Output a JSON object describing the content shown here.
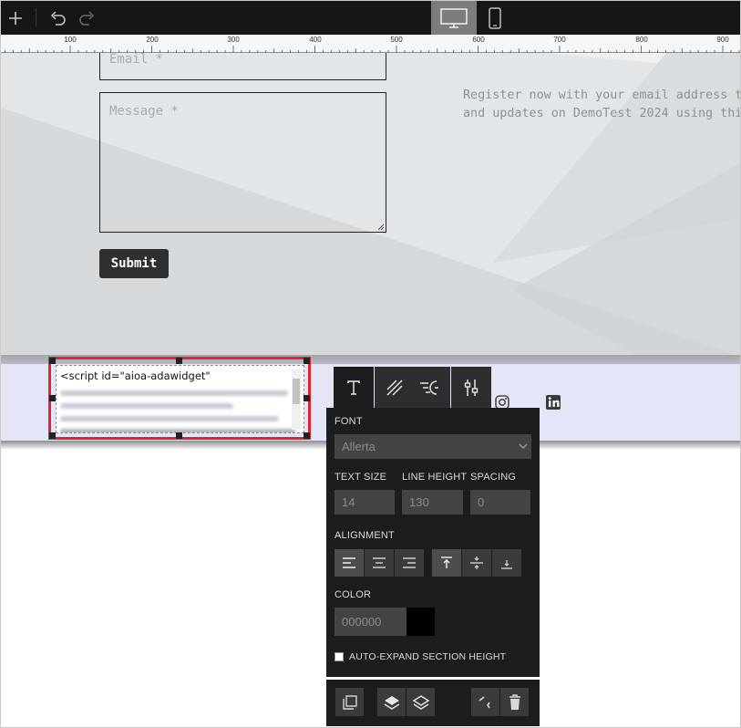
{
  "toolbar": {
    "add_icon": "plus-icon",
    "undo_icon": "undo-icon",
    "redo_icon": "redo-icon",
    "device_desktop_icon": "monitor-icon",
    "device_mobile_icon": "phone-icon",
    "active_device": "desktop"
  },
  "ruler": {
    "labels": [
      "100",
      "200",
      "300",
      "400",
      "500",
      "600",
      "700",
      "800",
      "900"
    ]
  },
  "form": {
    "email_placeholder": "Email *",
    "message_placeholder": "Message *",
    "submit_label": "Submit",
    "register_line1": "Register now with your email address t",
    "register_line2": "and updates on DemoTest 2024 using thi"
  },
  "embed": {
    "code_first_line": "<script id=\"aioa-adawidget\""
  },
  "social": {
    "icons": [
      "instagram-icon",
      "linkedin-icon"
    ]
  },
  "panel": {
    "tabs": [
      "text-icon",
      "style-icon",
      "animation-icon",
      "settings-icon"
    ],
    "font_label": "FONT",
    "font_value": "Allerta",
    "text_size_label": "TEXT SIZE",
    "text_size_value": "14",
    "line_height_label": "LINE HEIGHT",
    "line_height_value": "130",
    "spacing_label": "SPACING",
    "spacing_value": "0",
    "alignment_label": "ALIGNMENT",
    "color_label": "COLOR",
    "color_value": "000000",
    "auto_expand_label": "AUTO-EXPAND SECTION HEIGHT",
    "auto_expand_checked": false
  },
  "colors": {
    "toolbar_bg": "#161616",
    "selection_border": "#e3262b",
    "panel_bg": "#1d1d1d",
    "band_bg": "#e4e5f6",
    "submit_bg": "#2f2f2f"
  }
}
